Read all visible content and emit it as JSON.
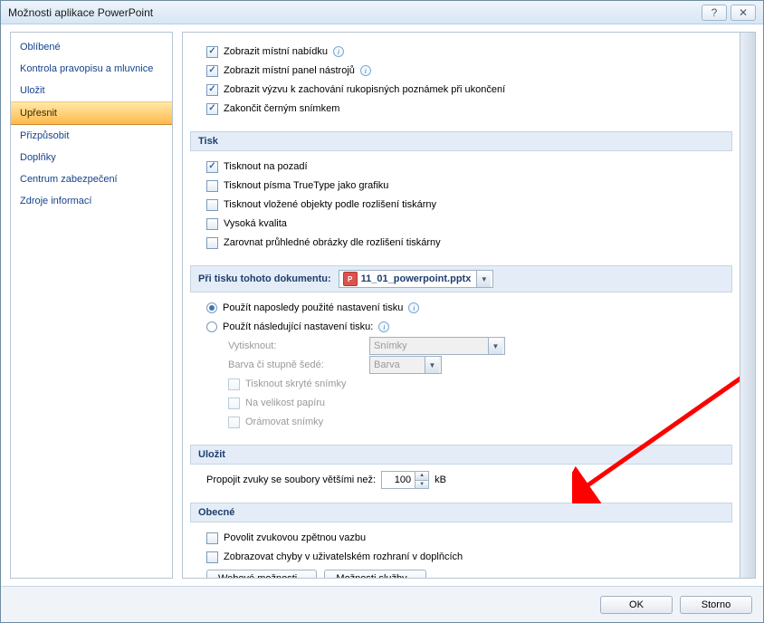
{
  "title": "Možnosti aplikace PowerPoint",
  "sidebar": {
    "items": [
      {
        "label": "Oblíbené"
      },
      {
        "label": "Kontrola pravopisu a mluvnice"
      },
      {
        "label": "Uložit"
      },
      {
        "label": "Upřesnit"
      },
      {
        "label": "Přizpůsobit"
      },
      {
        "label": "Doplňky"
      },
      {
        "label": "Centrum zabezpečení"
      },
      {
        "label": "Zdroje informací"
      }
    ]
  },
  "topchecks": {
    "c1": "Zobrazit místní nabídku",
    "c2": "Zobrazit místní panel nástrojů",
    "c3": "Zobrazit výzvu k zachování rukopisných poznámek při ukončení",
    "c4": "Zakončit černým snímkem"
  },
  "tisk": {
    "head": "Tisk",
    "c1": "Tisknout na pozadí",
    "c2": "Tisknout písma TrueType jako grafiku",
    "c3": "Tisknout vložené objekty podle rozlišení tiskárny",
    "c4": "Vysoká kvalita",
    "c5": "Zarovnat průhledné obrázky dle rozlišení tiskárny"
  },
  "doksec": {
    "head": "Při tisku tohoto dokumentu:",
    "filename": "11_01_powerpoint.pptx",
    "r1": "Použít naposledy použité nastavení tisku",
    "r2": "Použít následující nastavení tisku:",
    "vytisknout_label": "Vytisknout:",
    "vytisknout_val": "Snímky",
    "barva_label": "Barva či stupně šedé:",
    "barva_val": "Barva",
    "c1": "Tisknout skryté snímky",
    "c2": "Na velikost papíru",
    "c3": "Orámovat snímky"
  },
  "ulozit": {
    "head": "Uložit",
    "label": "Propojit zvuky se soubory většími než:",
    "value": "100",
    "unit": "kB"
  },
  "obecne": {
    "head": "Obecné",
    "c1": "Povolit zvukovou zpětnou vazbu",
    "c2": "Zobrazovat chyby v uživatelském rozhraní v doplňcích",
    "b1": "Webové možnosti...",
    "b2": "Možnosti služby..."
  },
  "footer": {
    "ok": "OK",
    "cancel": "Storno"
  }
}
